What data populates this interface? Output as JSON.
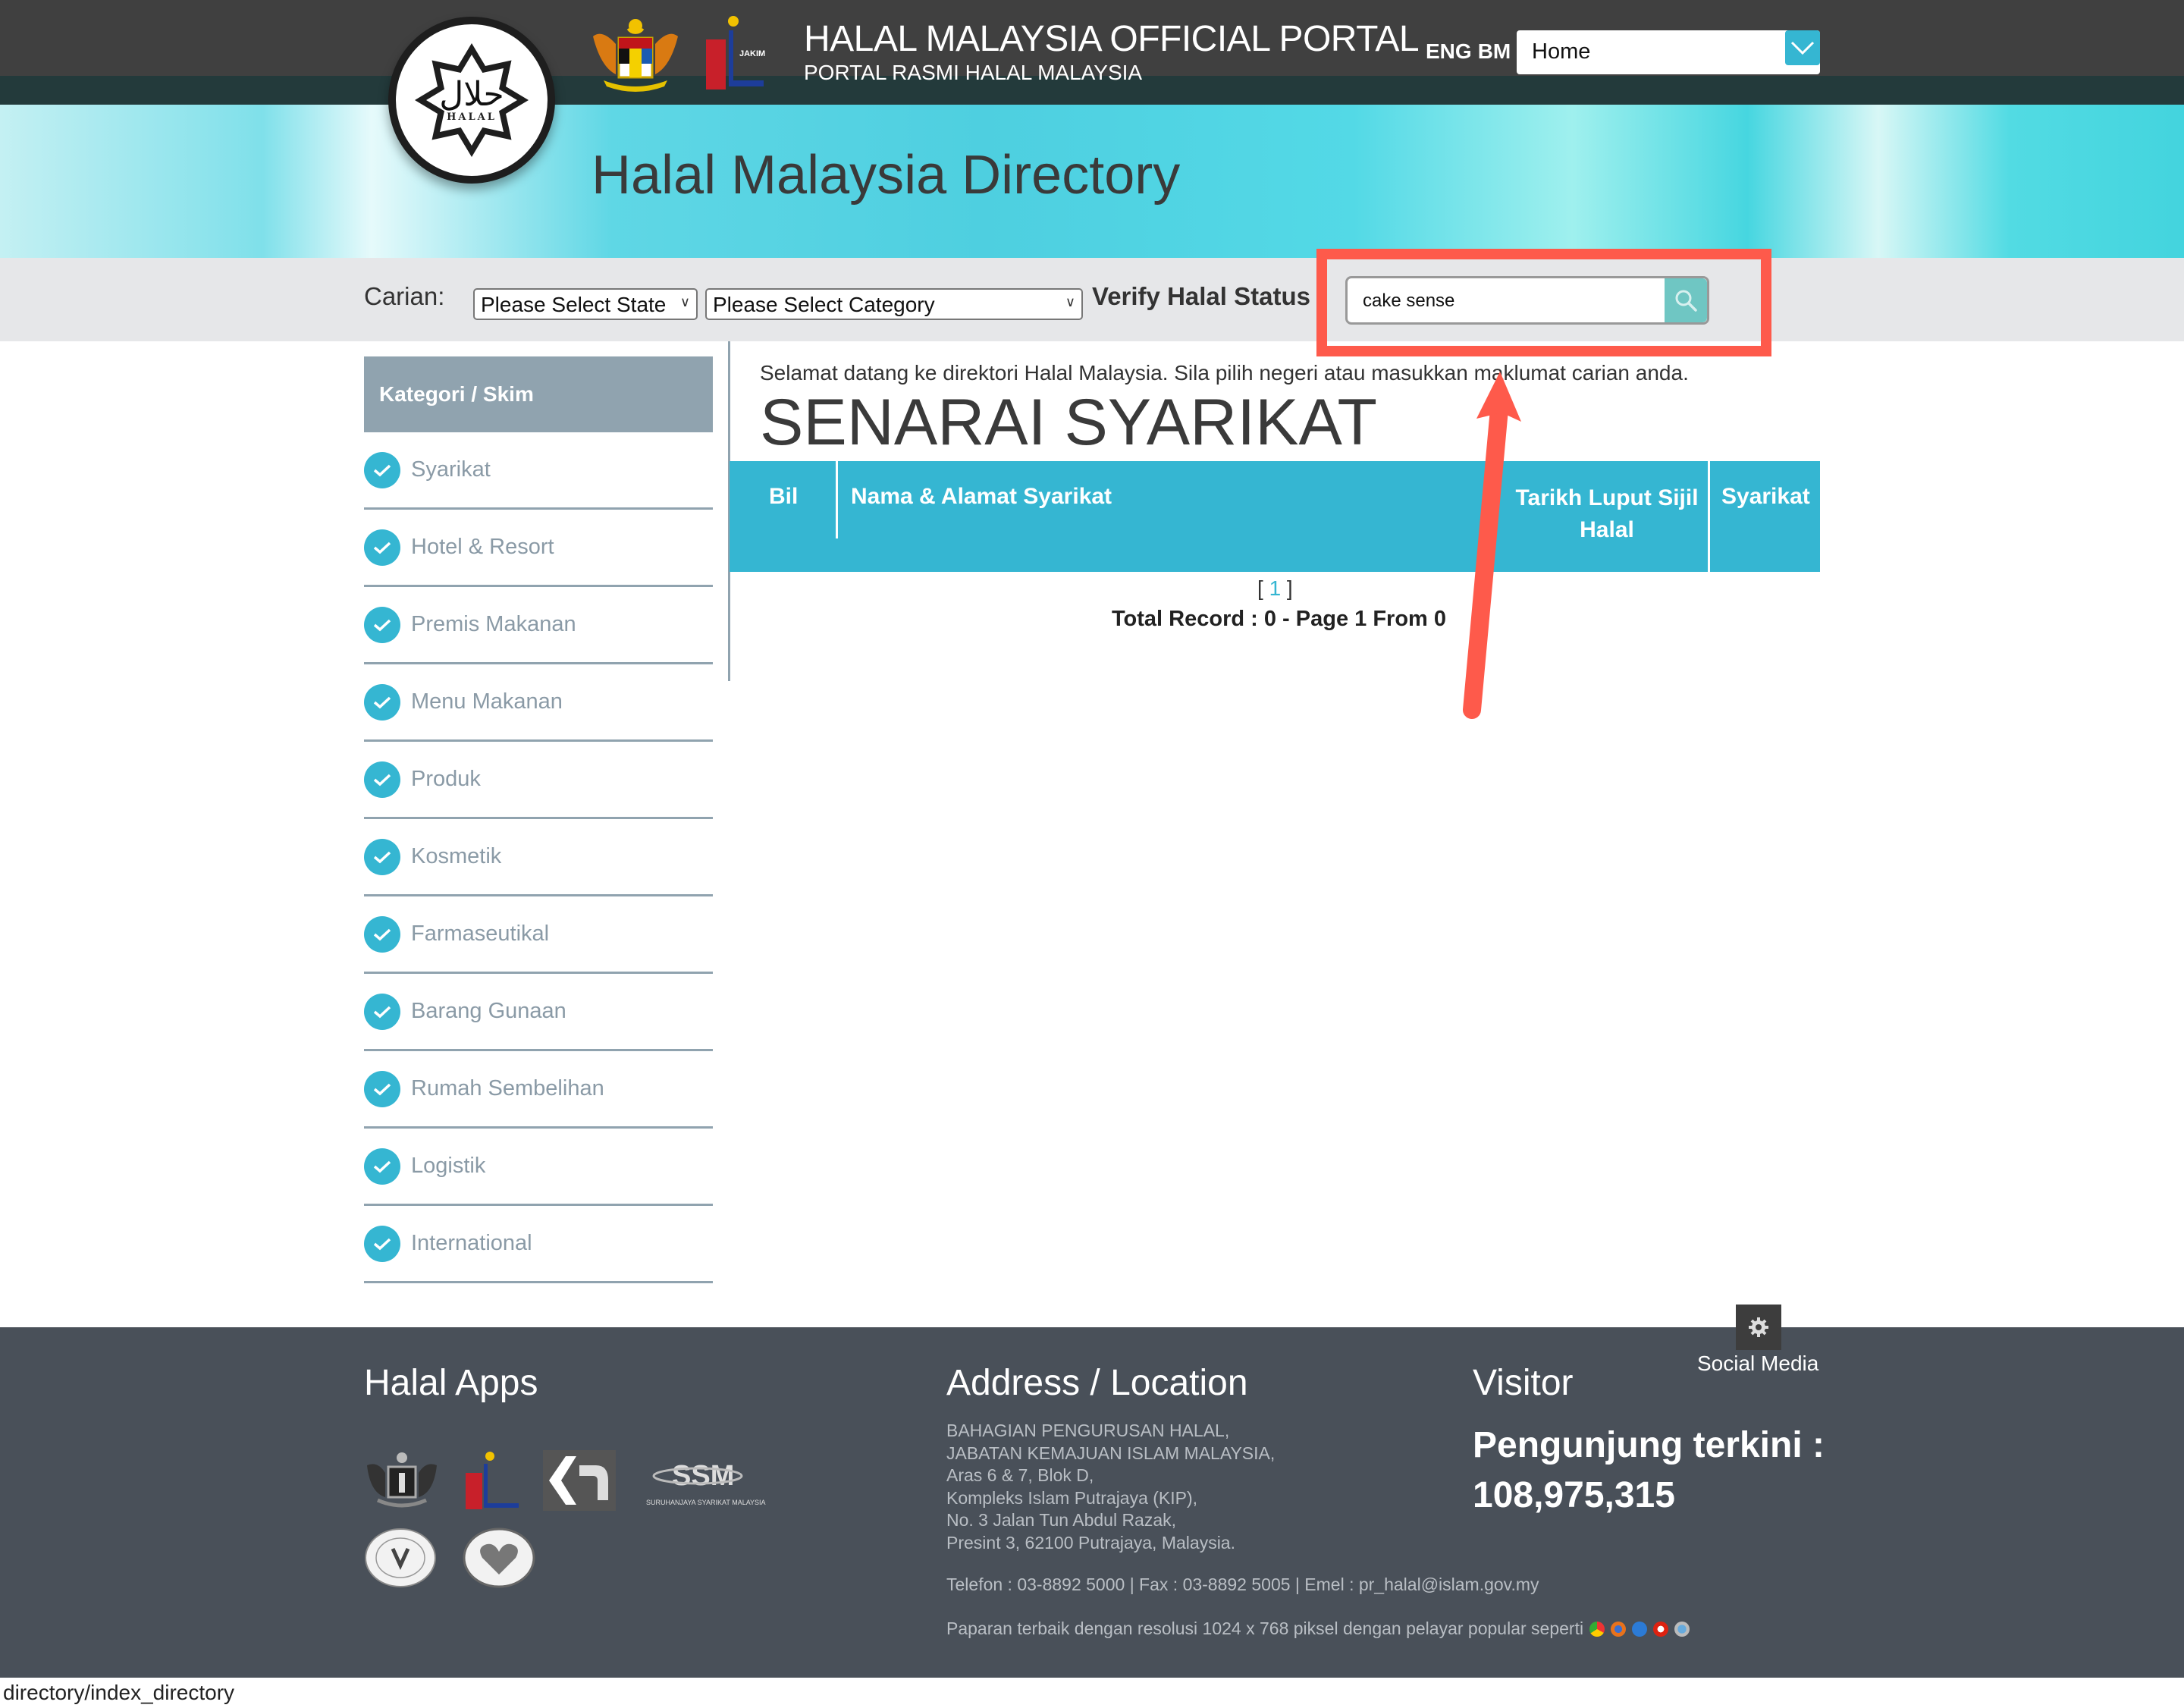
{
  "header": {
    "title": "HALAL MALAYSIA OFFICIAL PORTAL",
    "subtitle": "PORTAL RASMI HALAL MALAYSIA",
    "lang_eng": "ENG",
    "lang_bm": "BM",
    "nav_select_value": "Home",
    "logo_arabic": "حلال",
    "logo_text": "HALAL",
    "jakim_label": "JAKIM"
  },
  "banner": {
    "title": "Halal Malaysia Directory"
  },
  "search": {
    "label": "Carian:",
    "state_select": "Please Select State",
    "category_select": "Please Select Category",
    "verify_label": "Verify Halal Status",
    "query_value": "cake sense"
  },
  "sidebar": {
    "heading": "Kategori / Skim",
    "items": [
      {
        "label": "Syarikat"
      },
      {
        "label": "Hotel & Resort"
      },
      {
        "label": "Premis Makanan"
      },
      {
        "label": "Menu Makanan"
      },
      {
        "label": "Produk"
      },
      {
        "label": "Kosmetik"
      },
      {
        "label": "Farmaseutikal"
      },
      {
        "label": "Barang Gunaan"
      },
      {
        "label": "Rumah Sembelihan"
      },
      {
        "label": "Logistik"
      },
      {
        "label": "International"
      }
    ]
  },
  "main": {
    "welcome": "Selamat datang ke direktori Halal Malaysia. Sila pilih negeri atau masukkan maklumat carian anda.",
    "heading": "SENARAI SYARIKAT",
    "columns": {
      "bil": "Bil",
      "nama": "Nama & Alamat Syarikat",
      "tarikh_1": "Tarikh Luput Sijil",
      "tarikh_2": "Halal",
      "syarikat": "Syarikat"
    },
    "pager_open": "[ ",
    "pager_page": "1",
    "pager_close": " ]",
    "total": "Total Record : 0 - Page 1 From 0"
  },
  "footer": {
    "social_label": "Social Media",
    "apps_title": "Halal Apps",
    "address_title": "Address / Location",
    "address": "BAHAGIAN PENGURUSAN HALAL,\nJABATAN KEMAJUAN ISLAM MALAYSIA,\nAras 6 & 7, Blok D,\nKompleks Islam Putrajaya (KIP),\nNo. 3 Jalan Tun Abdul Razak,\nPresint 3, 62100 Putrajaya, Malaysia.",
    "contact": "Telefon : 03-8892 5000 | Fax : 03-8892 5005 | Emel : pr_halal@islam.gov.my",
    "best_view": "Paparan terbaik dengan resolusi 1024 x 768 piksel dengan pelayar popular seperti",
    "visitor_title": "Visitor",
    "visitor_label": "Pengunjung terkini :",
    "visitor_count": "108,975,315",
    "ssm_text": "SURUHANJAYA SYARIKAT MALAYSIA"
  },
  "status_bar": {
    "url": "directory/index_directory"
  },
  "colors": {
    "accent": "#35b6d2",
    "annotation": "#fe5a4b",
    "footer_bg": "#495059",
    "sidebar_head": "#90a3af"
  }
}
